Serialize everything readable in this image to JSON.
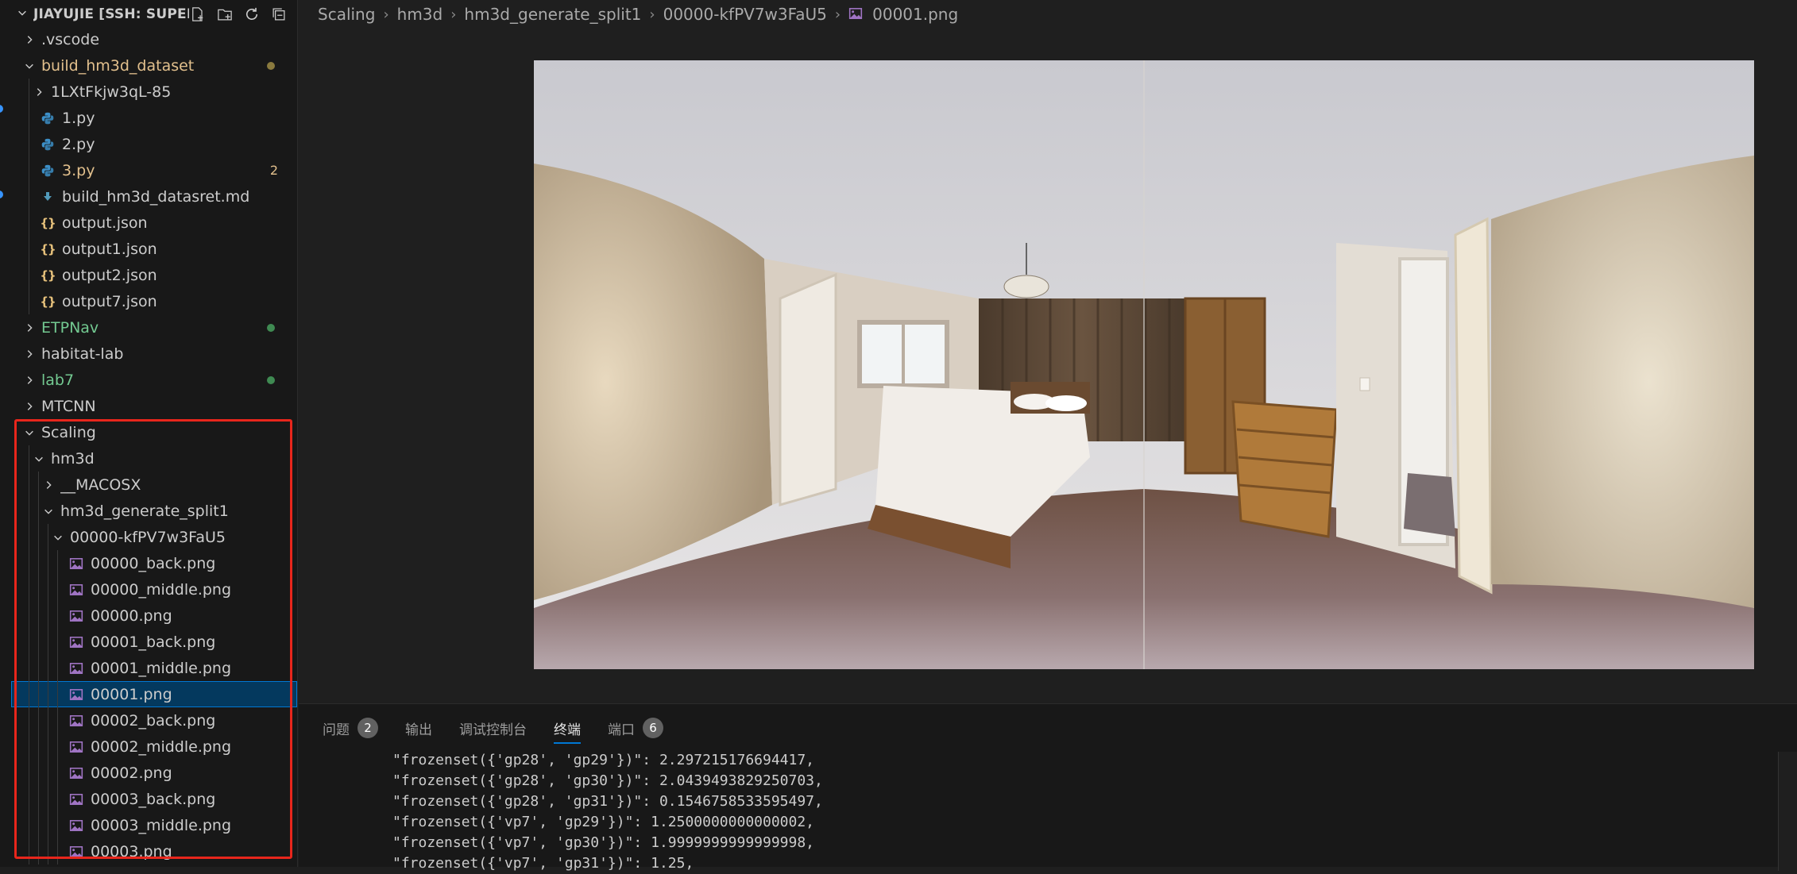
{
  "sidebar": {
    "header_title": "JIAYUJIE [SSH: SUPER...",
    "actions": [
      "new-file-icon",
      "new-folder-icon",
      "refresh-icon",
      "collapse-all-icon"
    ],
    "items": [
      {
        "label": ".vscode",
        "type": "folder",
        "expanded": false,
        "depth": 1
      },
      {
        "label": "build_hm3d_dataset",
        "type": "folder",
        "expanded": true,
        "depth": 1,
        "status": "modified",
        "decoration": "dot"
      },
      {
        "label": "1LXtFkjw3qL-85",
        "type": "folder",
        "expanded": false,
        "depth": 2
      },
      {
        "label": "1.py",
        "type": "python",
        "depth": 2
      },
      {
        "label": "2.py",
        "type": "python",
        "depth": 2
      },
      {
        "label": "3.py",
        "type": "python",
        "depth": 2,
        "status": "modified",
        "decoration": "2"
      },
      {
        "label": "build_hm3d_datasret.md",
        "type": "markdown",
        "depth": 2
      },
      {
        "label": "output.json",
        "type": "json",
        "depth": 2
      },
      {
        "label": "output1.json",
        "type": "json",
        "depth": 2
      },
      {
        "label": "output2.json",
        "type": "json",
        "depth": 2
      },
      {
        "label": "output7.json",
        "type": "json",
        "depth": 2
      },
      {
        "label": "ETPNav",
        "type": "folder",
        "expanded": false,
        "depth": 1,
        "status": "git-added",
        "decoration": "dot-green"
      },
      {
        "label": "habitat-lab",
        "type": "folder",
        "expanded": false,
        "depth": 1
      },
      {
        "label": "lab7",
        "type": "folder",
        "expanded": false,
        "depth": 1,
        "status": "git-added",
        "decoration": "dot-green"
      },
      {
        "label": "MTCNN",
        "type": "folder",
        "expanded": false,
        "depth": 1
      },
      {
        "label": "Scaling",
        "type": "folder",
        "expanded": true,
        "depth": 1
      },
      {
        "label": "hm3d",
        "type": "folder",
        "expanded": true,
        "depth": 2
      },
      {
        "label": "__MACOSX",
        "type": "folder",
        "expanded": false,
        "depth": 3
      },
      {
        "label": "hm3d_generate_split1",
        "type": "folder",
        "expanded": true,
        "depth": 3
      },
      {
        "label": "00000-kfPV7w3FaU5",
        "type": "folder",
        "expanded": true,
        "depth": 4
      },
      {
        "label": "00000_back.png",
        "type": "image",
        "depth": 5
      },
      {
        "label": "00000_middle.png",
        "type": "image",
        "depth": 5
      },
      {
        "label": "00000.png",
        "type": "image",
        "depth": 5
      },
      {
        "label": "00001_back.png",
        "type": "image",
        "depth": 5
      },
      {
        "label": "00001_middle.png",
        "type": "image",
        "depth": 5
      },
      {
        "label": "00001.png",
        "type": "image",
        "depth": 5,
        "selected": true
      },
      {
        "label": "00002_back.png",
        "type": "image",
        "depth": 5
      },
      {
        "label": "00002_middle.png",
        "type": "image",
        "depth": 5
      },
      {
        "label": "00002.png",
        "type": "image",
        "depth": 5
      },
      {
        "label": "00003_back.png",
        "type": "image",
        "depth": 5
      },
      {
        "label": "00003_middle.png",
        "type": "image",
        "depth": 5
      },
      {
        "label": "00003.png",
        "type": "image",
        "depth": 5
      }
    ]
  },
  "breadcrumb": [
    "Scaling",
    "hm3d",
    "hm3d_generate_split1",
    "00000-kfPV7w3FaU5",
    "00001.png"
  ],
  "panel": {
    "tabs": [
      {
        "label": "问题",
        "badge": "2"
      },
      {
        "label": "输出",
        "badge": null
      },
      {
        "label": "调试控制台",
        "badge": null
      },
      {
        "label": "终端",
        "badge": null,
        "active": true
      },
      {
        "label": "端口",
        "badge": "6"
      }
    ],
    "terminal_lines": [
      "\"frozenset({'gp28', 'gp29'})\": 2.297215176694417,",
      "\"frozenset({'gp28', 'gp30'})\": 2.0439493829250703,",
      "\"frozenset({'gp28', 'gp31'})\": 0.1546758533595497,",
      "\"frozenset({'vp7', 'gp29'})\": 1.2500000000000002,",
      "\"frozenset({'vp7', 'gp30'})\": 1.9999999999999998,",
      "\"frozenset({'vp7', 'gp31'})\": 1.25,"
    ]
  },
  "colors": {
    "selection": "#04395e",
    "modified": "#e2c08d",
    "added": "#73c991",
    "highlight_box": "#e8261c",
    "accent": "#0078d4"
  }
}
